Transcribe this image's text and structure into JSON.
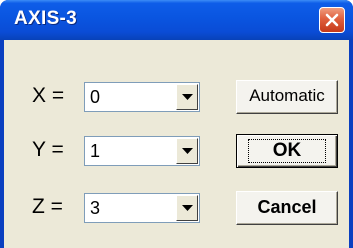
{
  "window": {
    "title": "AXIS-3"
  },
  "axes": [
    {
      "label": "X =",
      "value": "0"
    },
    {
      "label": "Y =",
      "value": "1"
    },
    {
      "label": "Z =",
      "value": "3"
    }
  ],
  "buttons": {
    "automatic": "Automatic",
    "ok": "OK",
    "cancel": "Cancel"
  },
  "icons": {
    "close": "close-icon",
    "dropdown": "chevron-down-icon"
  },
  "colors": {
    "titlebar": "#0a55e0",
    "client": "#ece9d8",
    "close_button": "#e0603e"
  }
}
